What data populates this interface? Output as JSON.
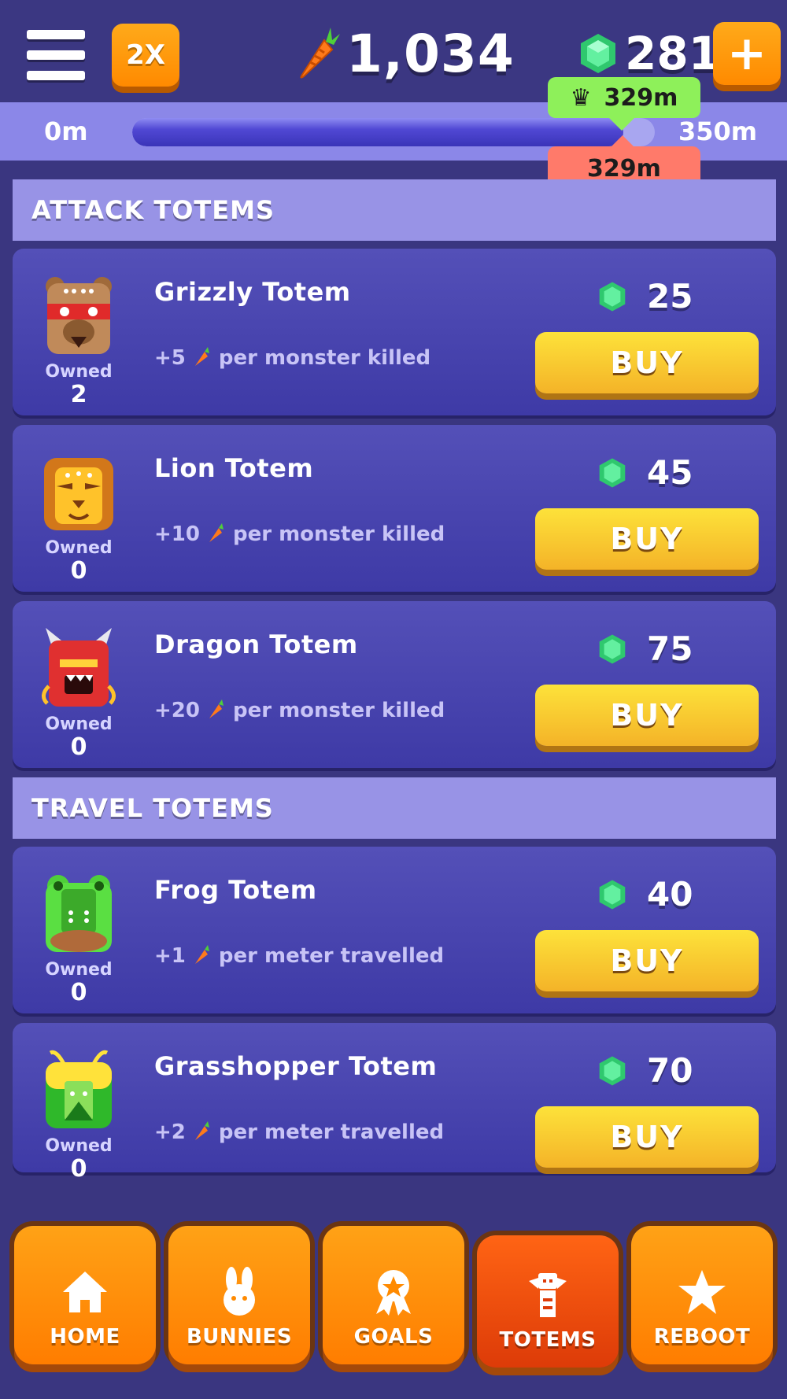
{
  "header": {
    "multiplier_label": "2X",
    "carrots": "1,034",
    "gems": "281",
    "add_label": "+"
  },
  "progress": {
    "start_label": "0m",
    "end_label": "350m",
    "best_label": "329m",
    "current_label": "329m",
    "fraction": 0.94
  },
  "sections": {
    "attack_title": "ATTACK TOTEMS",
    "travel_title": "TRAVEL TOTEMS"
  },
  "totems": [
    {
      "name": "Grizzly Totem",
      "desc_prefix": "+5",
      "desc_suffix": "per monster killed",
      "price": "25",
      "owned_label": "Owned",
      "owned": "2",
      "buy_label": "BUY",
      "icon": "grizzly-totem-icon"
    },
    {
      "name": "Lion Totem",
      "desc_prefix": "+10",
      "desc_suffix": "per monster killed",
      "price": "45",
      "owned_label": "Owned",
      "owned": "0",
      "buy_label": "BUY",
      "icon": "lion-totem-icon"
    },
    {
      "name": "Dragon Totem",
      "desc_prefix": "+20",
      "desc_suffix": "per monster killed",
      "price": "75",
      "owned_label": "Owned",
      "owned": "0",
      "buy_label": "BUY",
      "icon": "dragon-totem-icon"
    },
    {
      "name": "Frog Totem",
      "desc_prefix": "+1",
      "desc_suffix": "per meter travelled",
      "price": "40",
      "owned_label": "Owned",
      "owned": "0",
      "buy_label": "BUY",
      "icon": "frog-totem-icon"
    },
    {
      "name": "Grasshopper Totem",
      "desc_prefix": "+2",
      "desc_suffix": "per meter travelled",
      "price": "70",
      "owned_label": "Owned",
      "owned": "0",
      "buy_label": "BUY",
      "icon": "grasshopper-totem-icon"
    }
  ],
  "nav": {
    "home": "HOME",
    "bunnies": "BUNNIES",
    "goals": "GOALS",
    "totems": "TOTEMS",
    "reboot": "REBOOT",
    "active": "totems"
  },
  "colors": {
    "background": "#3a3680",
    "accent_orange": "#ff8a00",
    "buy_yellow": "#f4b328",
    "gem_green": "#3ee08a"
  }
}
